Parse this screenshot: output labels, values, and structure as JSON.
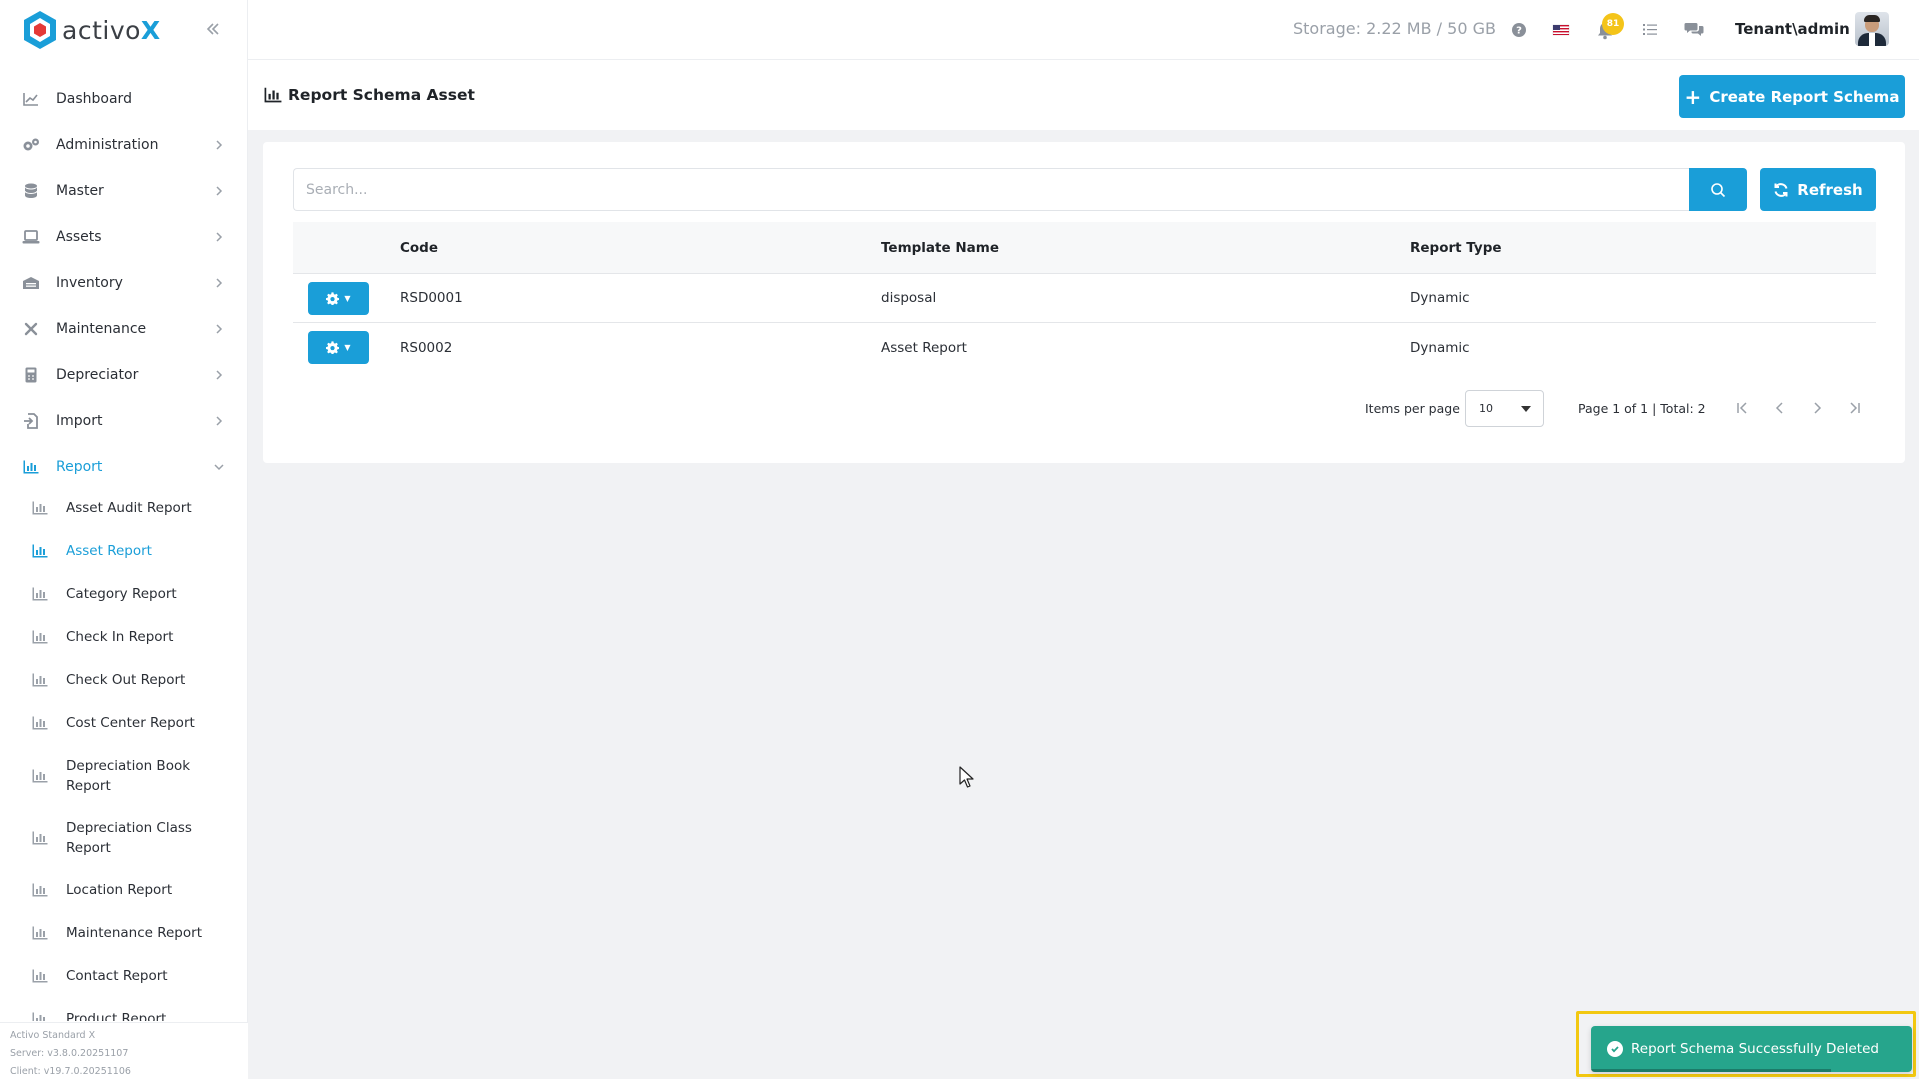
{
  "app": {
    "brand_prefix": "activo",
    "brand_suffix": "X",
    "accent_color": "#1a9ed8",
    "footer": {
      "edition": "Activo Standard X",
      "server": "Server: v3.8.0.20251107",
      "client": "Client: v19.7.0.20251106"
    }
  },
  "sidebar": {
    "menu": [
      {
        "label": "Dashboard",
        "icon": "chart-line-icon",
        "has_children": false
      },
      {
        "label": "Administration",
        "icon": "gears-icon",
        "has_children": true
      },
      {
        "label": "Master",
        "icon": "database-icon",
        "has_children": true
      },
      {
        "label": "Assets",
        "icon": "laptop-icon",
        "has_children": true
      },
      {
        "label": "Inventory",
        "icon": "warehouse-icon",
        "has_children": true
      },
      {
        "label": "Maintenance",
        "icon": "tools-icon",
        "has_children": true
      },
      {
        "label": "Depreciator",
        "icon": "calculator-icon",
        "has_children": true
      },
      {
        "label": "Import",
        "icon": "file-import-icon",
        "has_children": true
      },
      {
        "label": "Report",
        "icon": "bar-chart-icon",
        "has_children": true,
        "expanded": true
      }
    ],
    "report_children": [
      {
        "label": "Asset Audit Report"
      },
      {
        "label": "Asset Report",
        "active": true
      },
      {
        "label": "Category Report"
      },
      {
        "label": "Check In Report"
      },
      {
        "label": "Check Out Report"
      },
      {
        "label": "Cost Center Report"
      },
      {
        "label": "Depreciation Book Report"
      },
      {
        "label": "Depreciation Class Report"
      },
      {
        "label": "Location Report"
      },
      {
        "label": "Maintenance Report"
      },
      {
        "label": "Contact Report"
      },
      {
        "label": "Product Report"
      }
    ]
  },
  "topbar": {
    "storage": "Storage: 2.22 MB / 50 GB",
    "notification_count": "81",
    "user": "Tenant\\admin"
  },
  "page": {
    "title": "Report Schema Asset",
    "create_button": "Create Report Schema"
  },
  "search": {
    "placeholder": "Search...",
    "value": "",
    "refresh_label": "Refresh"
  },
  "table": {
    "columns": [
      "Code",
      "Template Name",
      "Report Type"
    ],
    "rows": [
      {
        "code": "RSD0001",
        "template_name": "disposal",
        "report_type": "Dynamic"
      },
      {
        "code": "RS0002",
        "template_name": "Asset Report",
        "report_type": "Dynamic"
      }
    ]
  },
  "pagination": {
    "items_per_page_label": "Items per page",
    "items_per_page": "10",
    "page_info": "Page 1 of 1 | Total: 2"
  },
  "toast": {
    "message": "Report Schema Successfully Deleted",
    "color": "#26a58c",
    "highlight_color": "#f2c811"
  }
}
